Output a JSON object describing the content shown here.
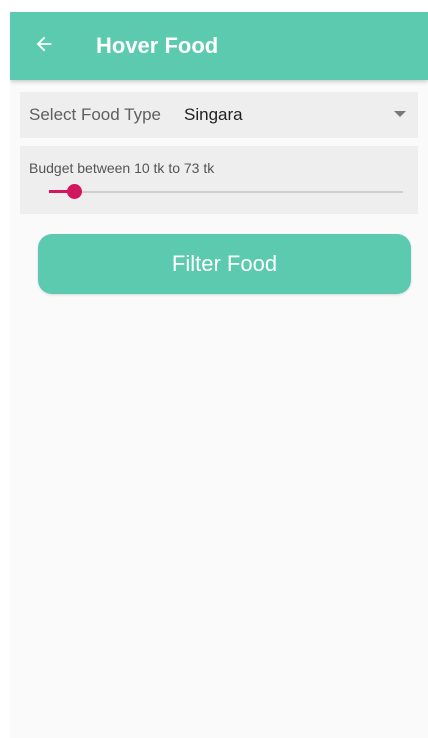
{
  "app_bar": {
    "title": "Hover Food",
    "back_icon": "arrow-left-icon",
    "color": "#5ccaae"
  },
  "food_type": {
    "label": "Select Food Type",
    "selected": "Singara",
    "dropdown_icon": "caret-down-icon"
  },
  "budget": {
    "label": "Budget between 10 tk to 73  tk",
    "slider_level": 0.07,
    "accent_color": "#d3175f"
  },
  "filter_button": {
    "label": "Filter Food"
  }
}
